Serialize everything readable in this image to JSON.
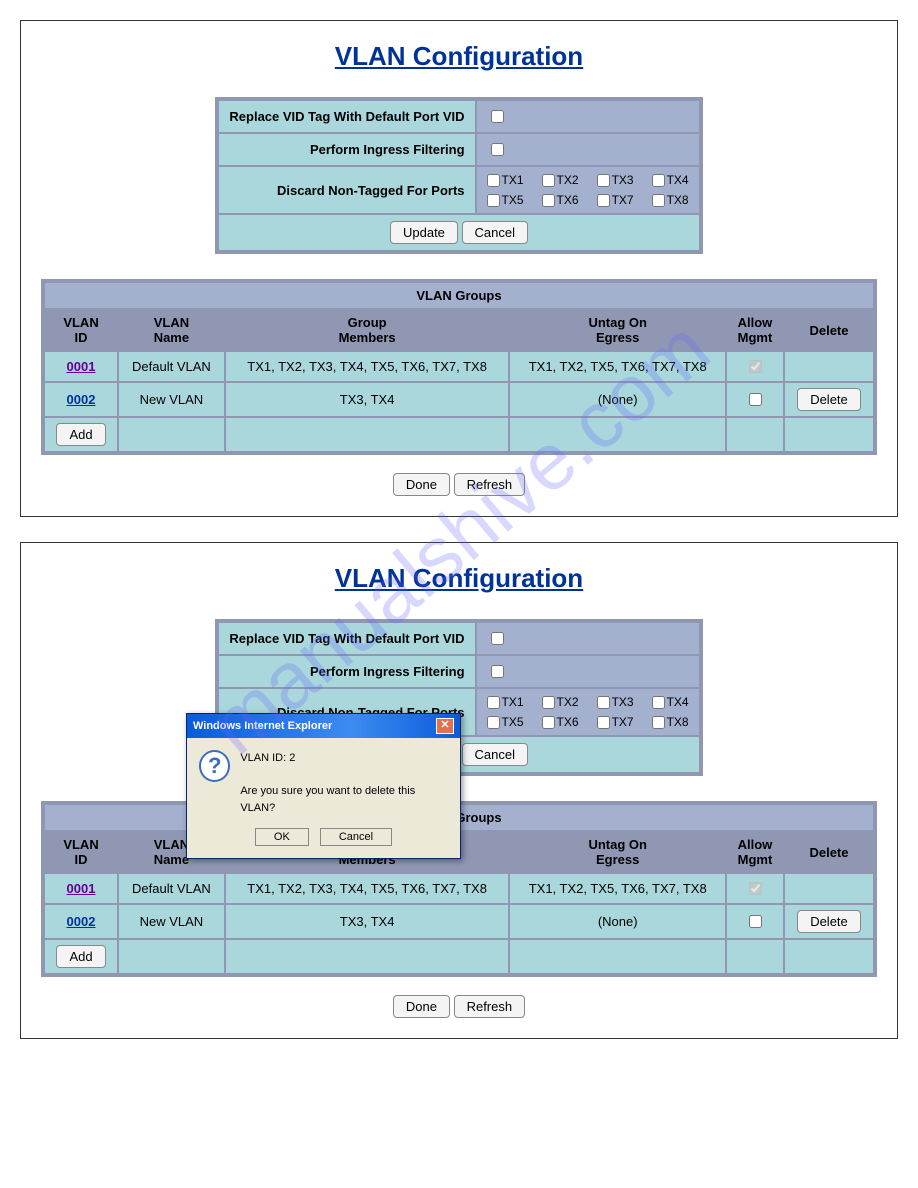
{
  "watermark": "manualshive.com",
  "page_title": "VLAN Configuration",
  "settings": {
    "replace_vid_label": "Replace VID Tag With Default Port VID",
    "ingress_label": "Perform Ingress Filtering",
    "discard_label": "Discard Non-Tagged For Ports",
    "ports": [
      "TX1",
      "TX2",
      "TX3",
      "TX4",
      "TX5",
      "TX6",
      "TX7",
      "TX8"
    ],
    "update_btn": "Update",
    "cancel_btn": "Cancel"
  },
  "groups": {
    "caption": "VLAN Groups",
    "headers": {
      "id_l1": "VLAN",
      "id_l2": "ID",
      "name_l1": "VLAN",
      "name_l2": "Name",
      "members_l1": "Group",
      "members_l2": "Members",
      "egress_l1": "Untag On",
      "egress_l2": "Egress",
      "mgmt_l1": "Allow",
      "mgmt_l2": "Mgmt",
      "delete": "Delete"
    },
    "rows": [
      {
        "id": "0001",
        "name": "Default VLAN",
        "members": "TX1, TX2, TX3, TX4, TX5, TX6, TX7, TX8",
        "egress": "TX1, TX2, TX5, TX6, TX7, TX8",
        "mgmt": true,
        "mgmt_disabled": true,
        "deletable": false
      },
      {
        "id": "0002",
        "name": "New VLAN",
        "members": "TX3, TX4",
        "egress": "(None)",
        "mgmt": false,
        "mgmt_disabled": false,
        "deletable": true
      }
    ],
    "add_btn": "Add",
    "delete_btn": "Delete"
  },
  "bottom": {
    "done": "Done",
    "refresh": "Refresh"
  },
  "dialog": {
    "title": "Windows Internet Explorer",
    "line1": "VLAN ID:  2",
    "line2": "Are you sure you want to delete this VLAN?",
    "ok": "OK",
    "cancel": "Cancel"
  }
}
